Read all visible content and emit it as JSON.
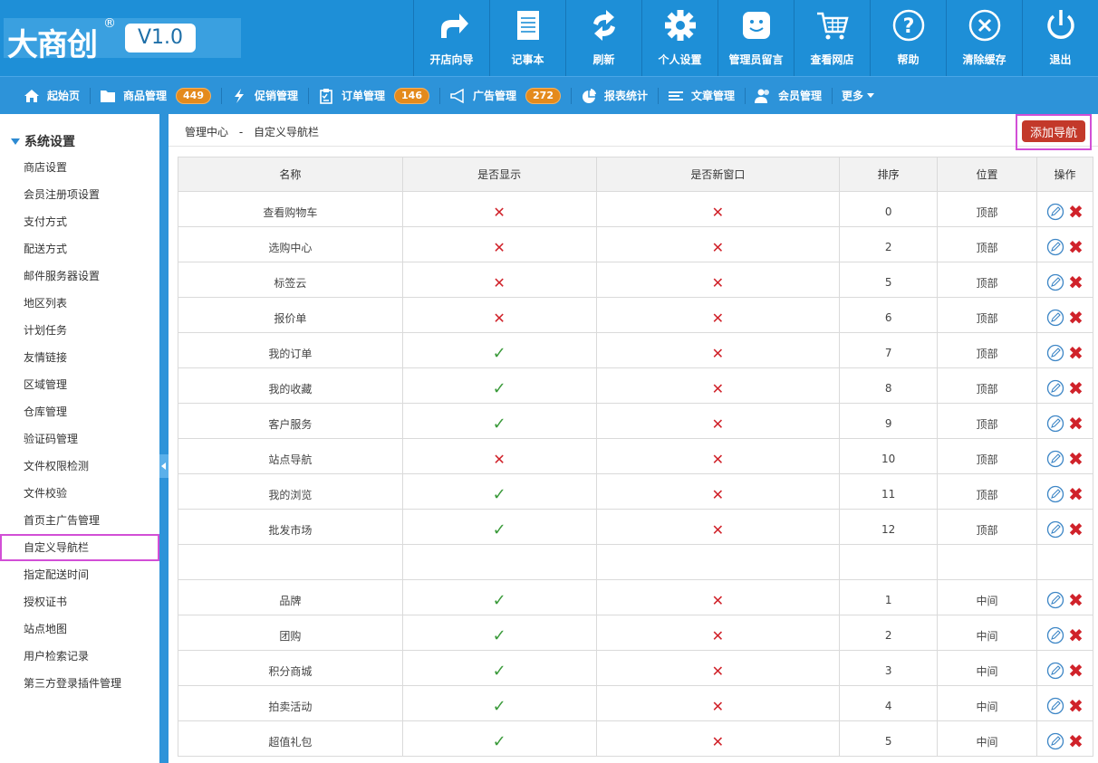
{
  "header": {
    "logo_text": "大商创",
    "logo_reg": "®",
    "version": "V1.0",
    "tools": [
      {
        "label": "开店向导",
        "icon": "share-arrow-icon"
      },
      {
        "label": "记事本",
        "icon": "notebook-icon"
      },
      {
        "label": "刷新",
        "icon": "refresh-icon"
      },
      {
        "label": "个人设置",
        "icon": "gear-icon"
      },
      {
        "label": "管理员留言",
        "icon": "chat-icon"
      },
      {
        "label": "查看网店",
        "icon": "cart-icon"
      },
      {
        "label": "帮助",
        "icon": "help-icon"
      },
      {
        "label": "清除缓存",
        "icon": "clear-icon"
      },
      {
        "label": "退出",
        "icon": "power-icon"
      }
    ]
  },
  "nav": {
    "items": [
      {
        "label": "起始页",
        "icon": "home-icon",
        "badge": ""
      },
      {
        "label": "商品管理",
        "icon": "folder-icon",
        "badge": "449"
      },
      {
        "label": "促销管理",
        "icon": "lightning-icon",
        "badge": ""
      },
      {
        "label": "订单管理",
        "icon": "clipboard-icon",
        "badge": "146"
      },
      {
        "label": "广告管理",
        "icon": "megaphone-icon",
        "badge": "272"
      },
      {
        "label": "报表统计",
        "icon": "pie-chart-icon",
        "badge": ""
      },
      {
        "label": "文章管理",
        "icon": "list-icon",
        "badge": ""
      },
      {
        "label": "会员管理",
        "icon": "users-icon",
        "badge": ""
      },
      {
        "label": "更多",
        "icon": "caret-down-icon",
        "badge": ""
      }
    ]
  },
  "sidebar": {
    "title": "系统设置",
    "items": [
      "商店设置",
      "会员注册项设置",
      "支付方式",
      "配送方式",
      "邮件服务器设置",
      "地区列表",
      "计划任务",
      "友情链接",
      "区域管理",
      "仓库管理",
      "验证码管理",
      "文件权限检测",
      "文件校验",
      "首页主广告管理",
      "自定义导航栏",
      "指定配送时间",
      "授权证书",
      "站点地图",
      "用户检索记录",
      "第三方登录插件管理"
    ],
    "active_index": 14
  },
  "breadcrumb": {
    "root": "管理中心",
    "sep": "-",
    "current": "自定义导航栏"
  },
  "add_button_label": "添加导航",
  "table": {
    "headers": [
      "名称",
      "是否显示",
      "是否新窗口",
      "排序",
      "位置",
      "操作"
    ],
    "rows": [
      {
        "name": "查看购物车",
        "show": false,
        "new_window": false,
        "order": "0",
        "position": "顶部"
      },
      {
        "name": "选购中心",
        "show": false,
        "new_window": false,
        "order": "2",
        "position": "顶部"
      },
      {
        "name": "标签云",
        "show": false,
        "new_window": false,
        "order": "5",
        "position": "顶部"
      },
      {
        "name": "报价单",
        "show": false,
        "new_window": false,
        "order": "6",
        "position": "顶部"
      },
      {
        "name": "我的订单",
        "show": true,
        "new_window": false,
        "order": "7",
        "position": "顶部"
      },
      {
        "name": "我的收藏",
        "show": true,
        "new_window": false,
        "order": "8",
        "position": "顶部"
      },
      {
        "name": "客户服务",
        "show": true,
        "new_window": false,
        "order": "9",
        "position": "顶部"
      },
      {
        "name": "站点导航",
        "show": false,
        "new_window": false,
        "order": "10",
        "position": "顶部"
      },
      {
        "name": "我的浏览",
        "show": true,
        "new_window": false,
        "order": "11",
        "position": "顶部"
      },
      {
        "name": "批发市场",
        "show": true,
        "new_window": false,
        "order": "12",
        "position": "顶部"
      },
      {
        "separator": true
      },
      {
        "name": "品牌",
        "show": true,
        "new_window": false,
        "order": "1",
        "position": "中间"
      },
      {
        "name": "团购",
        "show": true,
        "new_window": false,
        "order": "2",
        "position": "中间"
      },
      {
        "name": "积分商城",
        "show": true,
        "new_window": false,
        "order": "3",
        "position": "中间"
      },
      {
        "name": "拍卖活动",
        "show": true,
        "new_window": false,
        "order": "4",
        "position": "中间"
      },
      {
        "name": "超值礼包",
        "show": true,
        "new_window": false,
        "order": "5",
        "position": "中间"
      }
    ]
  },
  "colors": {
    "header_bg": "#1e8fd7",
    "nav_bg": "#2d93d9",
    "badge": "#e48a1c",
    "add_button": "#c3392a",
    "cross": "#d0222a",
    "check": "#3a9a3a",
    "highlight": "#d24fd6"
  }
}
